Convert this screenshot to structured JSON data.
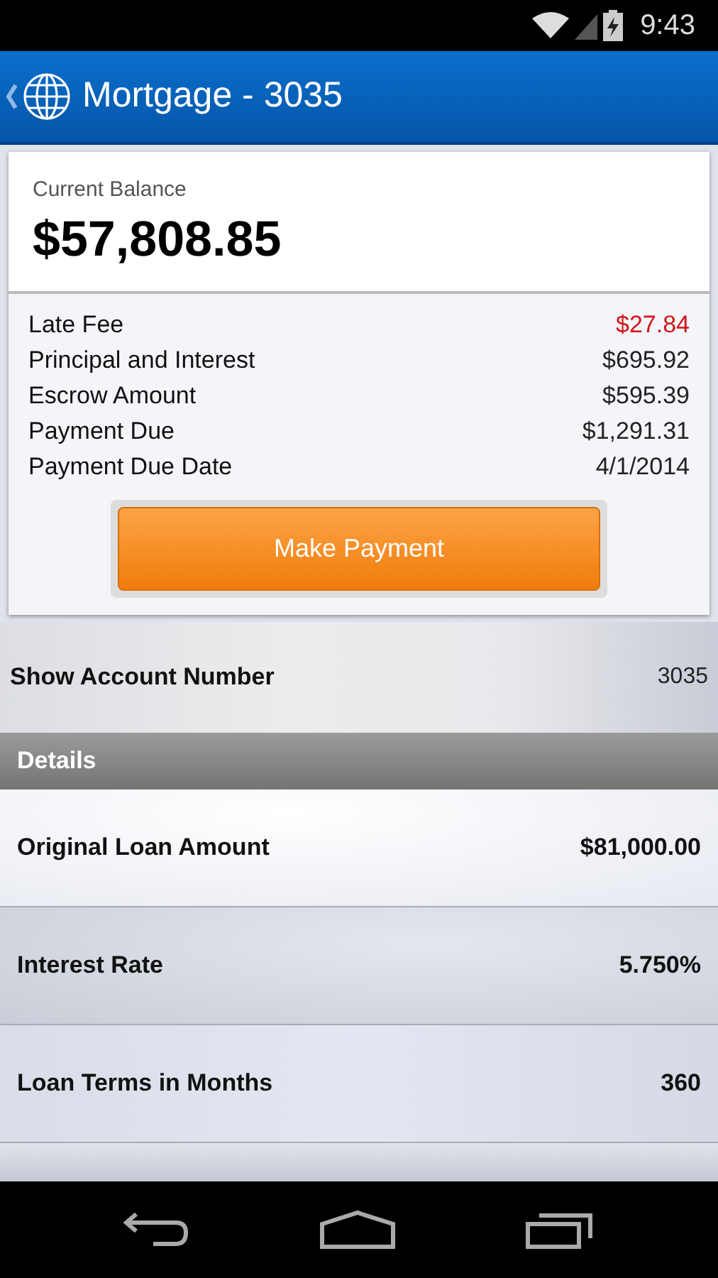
{
  "status_bar": {
    "time": "9:43"
  },
  "app_bar": {
    "title": "Mortgage - 3035"
  },
  "balance": {
    "label": "Current Balance",
    "amount": "$57,808.85"
  },
  "summary": [
    {
      "label": "Late Fee",
      "value": "$27.84",
      "color": "#d0141b"
    },
    {
      "label": "Principal and Interest",
      "value": "$695.92",
      "color": "#222222"
    },
    {
      "label": "Escrow Amount",
      "value": "$595.39",
      "color": "#222222"
    },
    {
      "label": "Payment Due",
      "value": "$1,291.31",
      "color": "#222222"
    },
    {
      "label": "Payment Due Date",
      "value": "4/1/2014",
      "color": "#222222"
    }
  ],
  "pay_button": "Make Payment",
  "account_row": {
    "label": "Show Account Number",
    "value": "3035"
  },
  "details": {
    "header": "Details",
    "rows": [
      {
        "label": "Original Loan Amount",
        "value": "$81,000.00"
      },
      {
        "label": "Interest Rate",
        "value": "5.750%"
      },
      {
        "label": "Loan Terms in Months",
        "value": "360"
      }
    ]
  }
}
